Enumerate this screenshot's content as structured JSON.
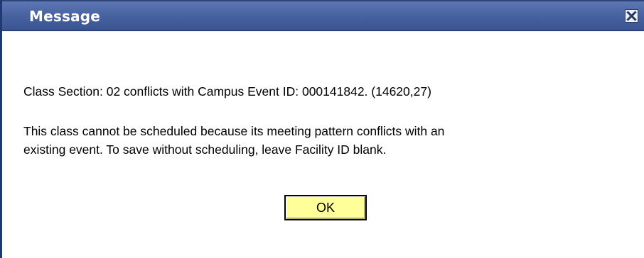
{
  "dialog": {
    "title": "Message",
    "close_icon": "close-x-icon",
    "message_line_1": "Class Section: 02 conflicts with Campus Event ID: 000141842. (14620,27)",
    "message_line_2": "This class cannot be scheduled because its meeting pattern conflicts with an",
    "message_line_3": "existing event.  To save without scheduling, leave Facility ID blank.",
    "ok_label": "OK"
  },
  "colors": {
    "titlebar": "#47609e",
    "title_text": "#ffffff",
    "ok_button_bg": "#ffff9a",
    "left_border": "#1f3a72"
  }
}
